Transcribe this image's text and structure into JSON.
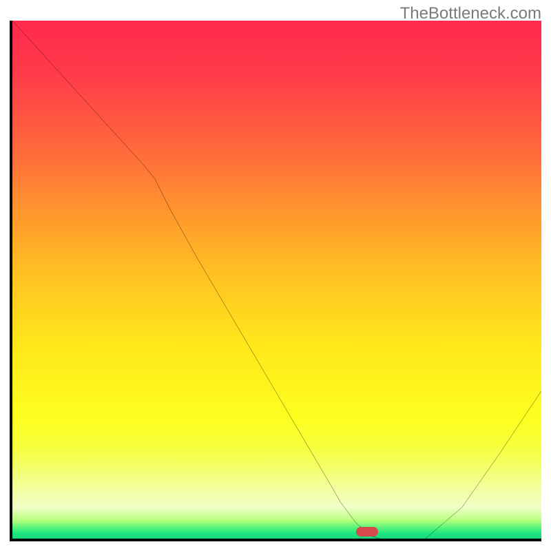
{
  "watermark": "TheBottleneck.com",
  "chart_data": {
    "type": "line",
    "title": "",
    "xlabel": "",
    "ylabel": "",
    "xlim": [
      0,
      100
    ],
    "ylim": [
      0,
      100
    ],
    "grid": false,
    "legend": false,
    "series": [
      {
        "name": "bottleneck-curve",
        "x": [
          0,
          10,
          20,
          25,
          27,
          30,
          35,
          40,
          45,
          50,
          55,
          60,
          62,
          65,
          68,
          72,
          78,
          85,
          92,
          100
        ],
        "y": [
          100,
          89,
          78,
          72.5,
          70,
          64,
          55,
          46.5,
          38,
          29.5,
          21,
          12.5,
          9,
          5,
          2.5,
          1.3,
          2,
          8,
          18,
          30
        ]
      }
    ],
    "marker": {
      "x": 67,
      "y": 1.3,
      "color": "#d44a4a"
    },
    "background": "rainbow-gradient"
  }
}
